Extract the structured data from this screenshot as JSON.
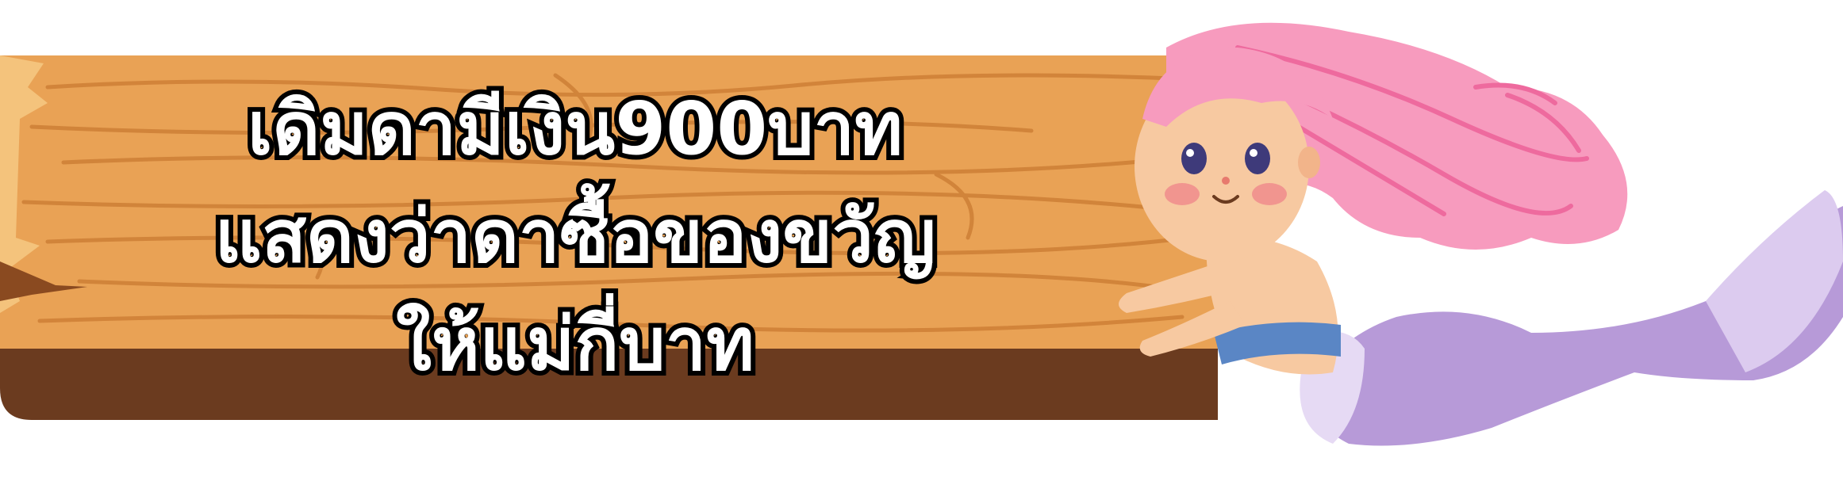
{
  "sign": {
    "lines": [
      "เดิมดามีเงิน900บาท",
      "แสดงว่าดาซื้อของขวัญ",
      "ให้แม่กี่บาท"
    ]
  },
  "colors": {
    "wood_light": "#E9A255",
    "wood_dark": "#6B3B1F",
    "wood_grain": "#C97A32",
    "hair": "#F79BBE",
    "tail": "#B79AD8",
    "top": "#5A86C5",
    "skin": "#F7C9A1"
  },
  "icons": [
    "wooden-sign",
    "mermaid-illustration"
  ]
}
